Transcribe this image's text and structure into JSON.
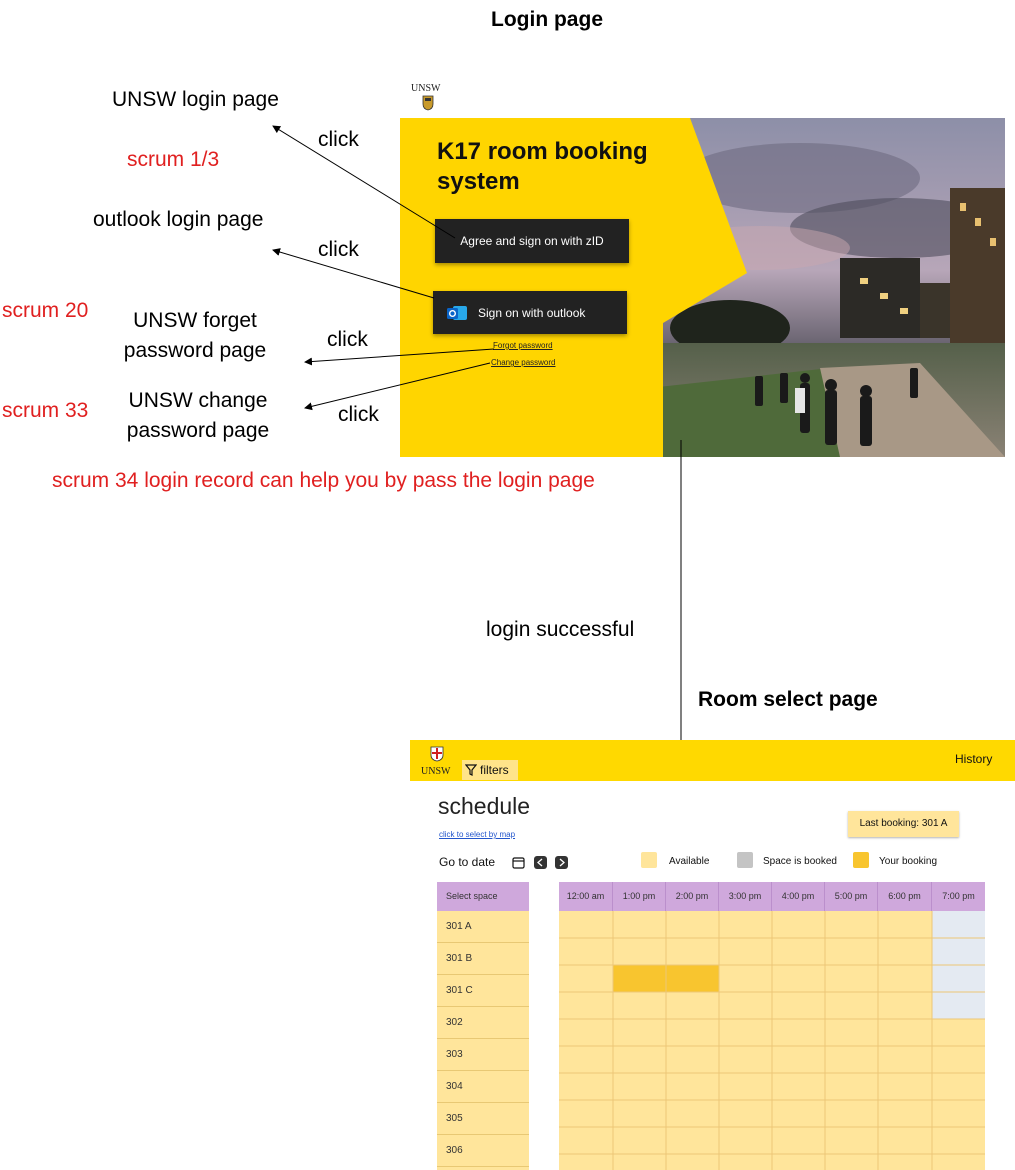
{
  "diagram": {
    "login_title": "Login page",
    "room_title": "Room select page",
    "notes": {
      "unsw_login": "UNSW login page",
      "scrum_1_3": "scrum 1/3",
      "outlook_login": "outlook login page",
      "scrum_20": "scrum 20",
      "forget_pw_line1": "UNSW forget",
      "forget_pw_line2": "password page",
      "scrum_33": "scrum 33",
      "change_pw_line1": "UNSW change",
      "change_pw_line2": "password page",
      "scrum_34": "scrum 34 login record can help you by pass the login page",
      "login_success": "login successful"
    },
    "arrow_label": "click"
  },
  "login_mock": {
    "logo": "UNSW",
    "heading": "K17 room booking system",
    "zid_button": "Agree and sign on with zID",
    "outlook_button": "Sign on with outlook",
    "forgot_link": "Forgot password",
    "change_link": "Change password"
  },
  "room_mock": {
    "logo": "UNSW",
    "filters": "filters",
    "history": "History",
    "schedule_title": "schedule",
    "map_link": "click to select by map",
    "last_booking": "Last booking: 301 A",
    "go_to_date": "Go to date",
    "legend": {
      "available": "Available",
      "booked": "Space is booked",
      "yours": "Your booking"
    },
    "legend_colors": {
      "available": "#ffe59b",
      "booked": "#c4c4c4",
      "yours": "#f8c52f"
    },
    "select_space": "Select space",
    "spaces": [
      "301 A",
      "301 B",
      "301 C",
      "302",
      "303",
      "304",
      "305",
      "306"
    ],
    "times": [
      "12:00 am",
      "1:00 pm",
      "2:00 pm",
      "3:00 pm",
      "4:00 pm",
      "5:00 pm",
      "6:00 pm",
      "7:00 pm"
    ]
  }
}
